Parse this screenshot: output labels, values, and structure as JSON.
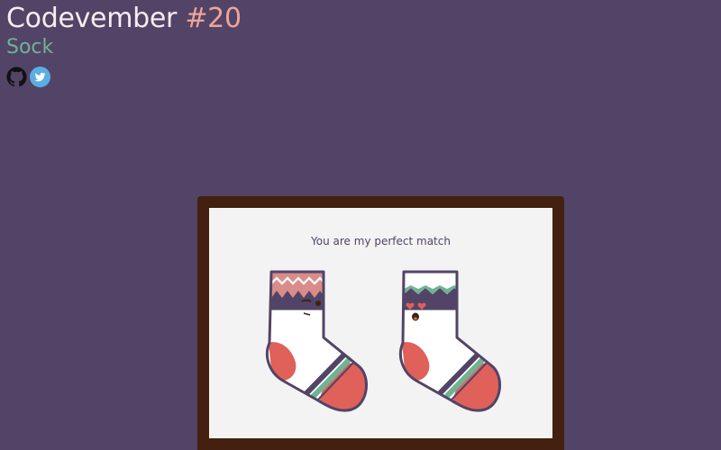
{
  "header": {
    "title": "Codevember",
    "number": "#20",
    "subtitle": "Sock"
  },
  "social": {
    "github_label": "GitHub",
    "twitter_label": "Twitter"
  },
  "card": {
    "message": "You are my perfect match"
  },
  "colors": {
    "background": "#524466",
    "title": "#f4eef0",
    "accent": "#f0a39a",
    "subtitle": "#6fb394",
    "frame": "#43200f",
    "canvas": "#f3f3f3",
    "sock_outline": "#524466",
    "sock_red": "#e0605a",
    "sock_pink": "#d98c8a",
    "sock_green": "#6fb394"
  }
}
